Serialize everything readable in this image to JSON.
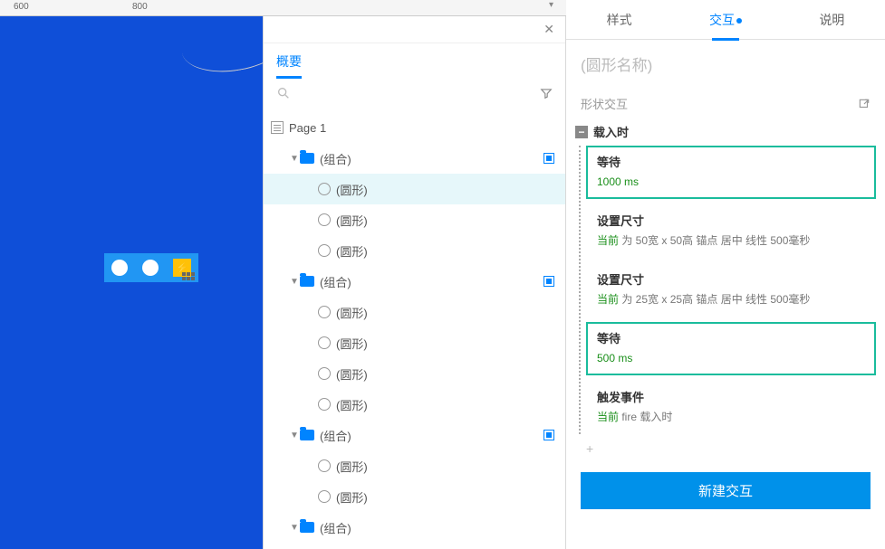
{
  "ruler": {
    "marks": [
      "600",
      "800"
    ],
    "positions": [
      15,
      146
    ]
  },
  "outline": {
    "tab": "概要",
    "page_label": "Page 1",
    "tree": [
      {
        "type": "group",
        "label": "(组合)",
        "depth": 1,
        "caret": true,
        "endbox": true
      },
      {
        "type": "circle",
        "label": "(圆形)",
        "depth": 2,
        "selected": true
      },
      {
        "type": "circle",
        "label": "(圆形)",
        "depth": 2
      },
      {
        "type": "circle",
        "label": "(圆形)",
        "depth": 2
      },
      {
        "type": "group",
        "label": "(组合)",
        "depth": 1,
        "caret": true,
        "endbox": true
      },
      {
        "type": "circle",
        "label": "(圆形)",
        "depth": 2
      },
      {
        "type": "circle",
        "label": "(圆形)",
        "depth": 2
      },
      {
        "type": "circle",
        "label": "(圆形)",
        "depth": 2
      },
      {
        "type": "circle",
        "label": "(圆形)",
        "depth": 2
      },
      {
        "type": "group",
        "label": "(组合)",
        "depth": 1,
        "caret": true,
        "endbox": true
      },
      {
        "type": "circle",
        "label": "(圆形)",
        "depth": 2
      },
      {
        "type": "circle",
        "label": "(圆形)",
        "depth": 2
      },
      {
        "type": "group",
        "label": "(组合)",
        "depth": 1,
        "caret": true
      }
    ]
  },
  "right": {
    "tabs": {
      "style": "样式",
      "interaction": "交互",
      "notes": "说明"
    },
    "shape_name_placeholder": "(圆形名称)",
    "section_label": "形状交互",
    "event_name": "载入时",
    "actions": [
      {
        "title": "等待",
        "detail_green": "1000 ms",
        "detail_grey": "",
        "highlighted": true
      },
      {
        "title": "设置尺寸",
        "detail_green": "当前",
        "detail_grey": " 为 50宽 x 50高  锚点 居中 线性 500毫秒",
        "highlighted": false
      },
      {
        "title": "设置尺寸",
        "detail_green": "当前",
        "detail_grey": " 为 25宽 x 25高  锚点 居中 线性 500毫秒",
        "highlighted": false
      },
      {
        "title": "等待",
        "detail_green": "500 ms",
        "detail_grey": "",
        "highlighted": true
      },
      {
        "title": "触发事件",
        "detail_green": "当前",
        "detail_grey": " fire 载入时",
        "highlighted": false
      }
    ],
    "add_action": "+",
    "new_interaction_btn": "新建交互"
  }
}
